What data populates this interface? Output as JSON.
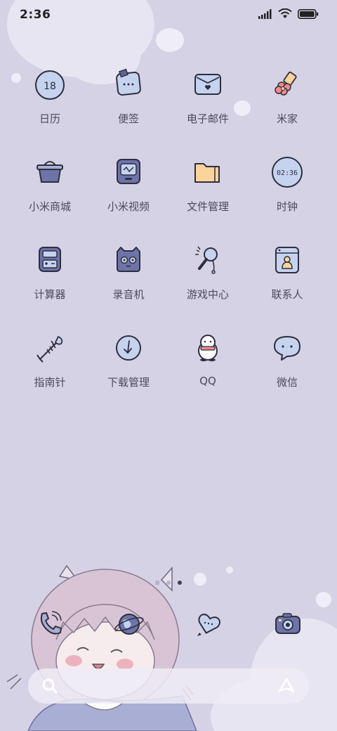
{
  "status": {
    "time": "2:36"
  },
  "apps": [
    {
      "id": "calendar",
      "label": "日历",
      "icon": "calendar-icon",
      "badge": "18"
    },
    {
      "id": "notes",
      "label": "便签",
      "icon": "notes-icon"
    },
    {
      "id": "email",
      "label": "电子邮件",
      "icon": "envelope-icon"
    },
    {
      "id": "mijia",
      "label": "米家",
      "icon": "flower-plug-icon"
    },
    {
      "id": "mall",
      "label": "小米商城",
      "icon": "basket-icon"
    },
    {
      "id": "video",
      "label": "小米视频",
      "icon": "tv-icon"
    },
    {
      "id": "files",
      "label": "文件管理",
      "icon": "folder-icon"
    },
    {
      "id": "clock",
      "label": "时钟",
      "icon": "clock-icon",
      "clock_text": "02:36"
    },
    {
      "id": "calculator",
      "label": "计算器",
      "icon": "calculator-icon"
    },
    {
      "id": "recorder",
      "label": "录音机",
      "icon": "cat-recorder-icon"
    },
    {
      "id": "games",
      "label": "游戏中心",
      "icon": "magnifier-game-icon"
    },
    {
      "id": "contacts",
      "label": "联系人",
      "icon": "contact-card-icon"
    },
    {
      "id": "compass",
      "label": "指南针",
      "icon": "fish-bone-icon"
    },
    {
      "id": "downloads",
      "label": "下载管理",
      "icon": "download-icon"
    },
    {
      "id": "qq",
      "label": "QQ",
      "icon": "penguin-icon"
    },
    {
      "id": "wechat",
      "label": "微信",
      "icon": "chat-bubble-icon"
    }
  ],
  "dock": [
    {
      "id": "phone",
      "icon": "phone-icon"
    },
    {
      "id": "browser",
      "icon": "globe-icon"
    },
    {
      "id": "messages",
      "icon": "heart-message-icon"
    },
    {
      "id": "camera",
      "icon": "camera-icon"
    }
  ],
  "page_indicator": {
    "count": 3,
    "active_index": 2
  },
  "search": {
    "icon": "search-icon",
    "assistant_icon": "assistant-icon"
  },
  "colors": {
    "background": "#d6d2e6",
    "icon_fill": "#c5d3ef",
    "icon_dark": "#5e6796",
    "folder": "#fbd49b",
    "outline": "#2e2e3e"
  }
}
